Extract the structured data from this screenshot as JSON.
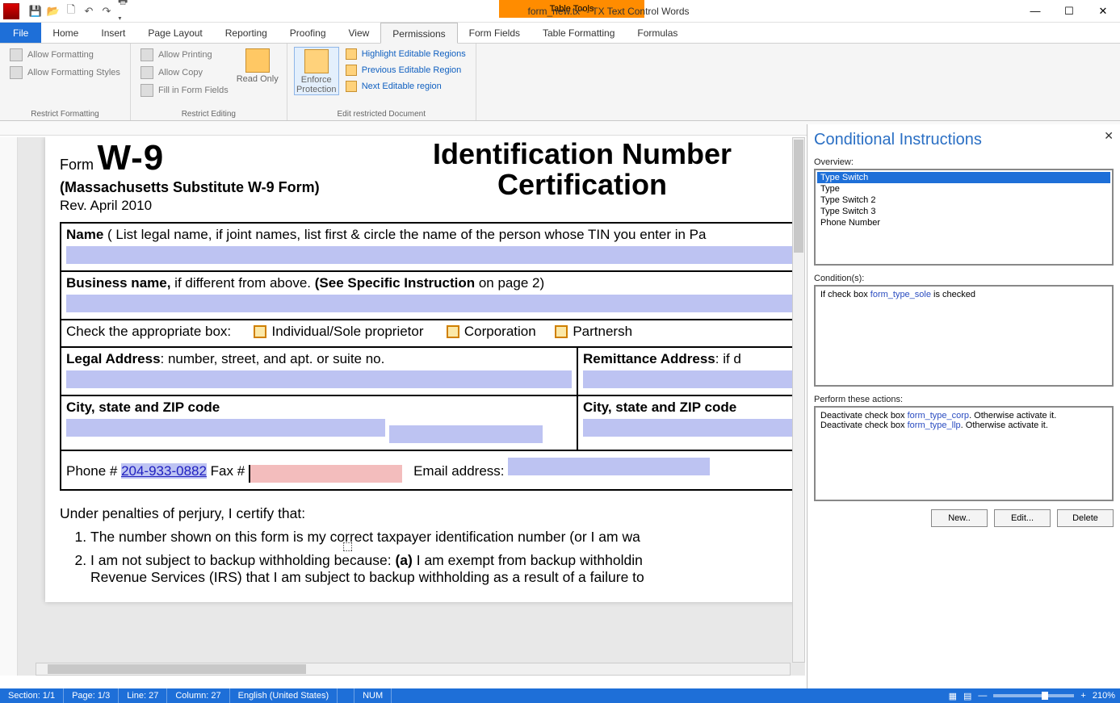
{
  "window": {
    "title": "form_new.tx* - TX Text Control Words",
    "table_tools": "Table Tools"
  },
  "tabs": {
    "file": "File",
    "home": "Home",
    "insert": "Insert",
    "pagelayout": "Page Layout",
    "reporting": "Reporting",
    "proofing": "Proofing",
    "view": "View",
    "permissions": "Permissions",
    "formfields": "Form Fields",
    "tableformatting": "Table Formatting",
    "formulas": "Formulas"
  },
  "ribbon": {
    "restrict_formatting": {
      "allow_formatting": "Allow Formatting",
      "allow_formatting_styles": "Allow Formatting Styles",
      "group": "Restrict Formatting"
    },
    "restrict_editing": {
      "allow_printing": "Allow Printing",
      "allow_copy": "Allow Copy",
      "fill_form_fields": "Fill in Form Fields",
      "read_only": "Read Only",
      "group": "Restrict Editing"
    },
    "edit_restricted": {
      "enforce_protection": "Enforce Protection",
      "highlight": "Highlight Editable Regions",
      "previous": "Previous Editable Region",
      "next": "Next Editable region",
      "group": "Edit restricted Document"
    }
  },
  "doc": {
    "form_label": "Form",
    "form_code": "W-9",
    "sub1": "(Massachusetts Substitute W-9 Form)",
    "sub2": "Rev. April 2010",
    "title_line1": "Identification Number",
    "title_line2": "Certification",
    "name_label": "Name",
    "name_desc": " ( List legal name, if joint names, list first & circle the name of the person whose TIN you enter in Pa",
    "business_label": "Business name,",
    "business_desc": " if different from above. ",
    "business_bold2": "(See Specific Instruction",
    "business_tail": " on page 2)",
    "checkbox_label": "Check the appropriate box:",
    "cb1": "Individual/Sole proprietor",
    "cb2": "Corporation",
    "cb3": "Partnersh",
    "legal_addr_label": "Legal Address",
    "legal_addr_desc": ": number, street, and apt. or suite no.",
    "remit_label": "Remittance Address",
    "remit_desc": ": if d",
    "city_label": "City, state and ZIP code",
    "city_label2": "City, state and ZIP code",
    "phone_label": "Phone # ",
    "phone_value": "204-933-0882",
    "fax_label": " Fax # ",
    "email_label": "Email address:",
    "certify_head": "Under penalties of perjury, I certify that:",
    "cert_1": "The number shown on this form is my correct taxpayer identification number (or I am wa",
    "cert_2a": "I am not subject to backup withholding because: ",
    "cert_2b": "(a)",
    "cert_2c": " I am exempt from backup withholdin",
    "cert_2d": "Revenue Services (IRS) that I am subject to backup withholding as a result of a failure to"
  },
  "panel": {
    "title": "Conditional Instructions",
    "overview_label": "Overview:",
    "items": [
      "Type Switch",
      "Type",
      "Type Switch 2",
      "Type Switch 3",
      "Phone Number"
    ],
    "conditions_label": "Condition(s):",
    "cond_pre": "If check box ",
    "cond_ref": "form_type_sole",
    "cond_post": " is checked",
    "actions_label": "Perform these actions:",
    "act1_pre": "Deactivate check box ",
    "act1_ref": "form_type_corp",
    "act1_post": ". Otherwise activate it.",
    "act2_pre": "Deactivate check box ",
    "act2_ref": "form_type_llp",
    "act2_post": ". Otherwise activate it.",
    "btn_new": "New..",
    "btn_edit": "Edit...",
    "btn_delete": "Delete"
  },
  "status": {
    "section": "Section: 1/1",
    "page": "Page: 1/3",
    "line": "Line: 27",
    "column": "Column: 27",
    "lang": "English (United States)",
    "num": "NUM",
    "zoom": "210%"
  }
}
